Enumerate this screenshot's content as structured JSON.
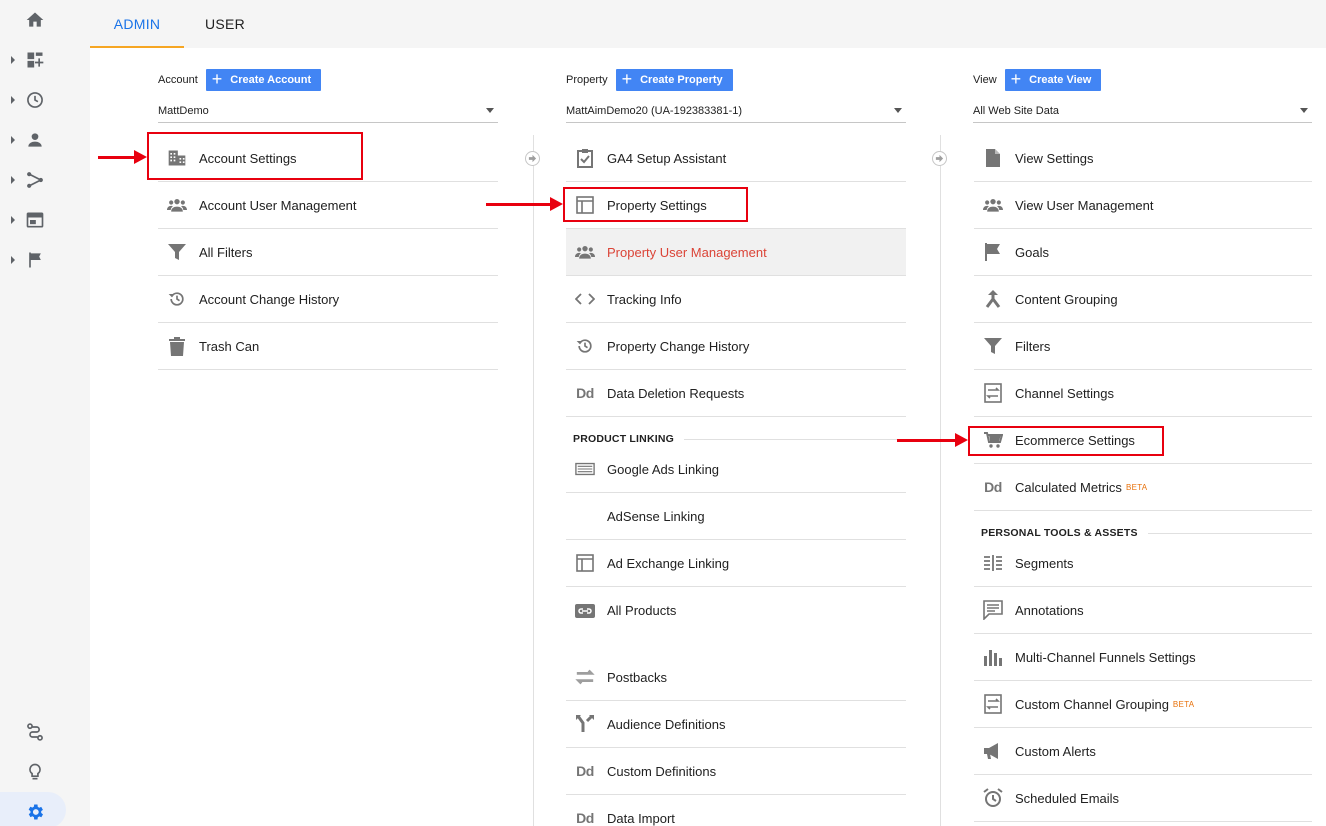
{
  "tabs": [
    {
      "label": "ADMIN",
      "active": true
    },
    {
      "label": "USER",
      "active": false
    }
  ],
  "rail": {
    "items": [
      "home-icon",
      "dashboard-icon",
      "realtime-icon",
      "audience-icon",
      "acquisition-icon",
      "behavior-icon",
      "conversions-icon"
    ],
    "bottom": [
      "attribution-icon",
      "discover-icon",
      "admin-gear-icon"
    ]
  },
  "account": {
    "label": "Account",
    "create_label": "Create Account",
    "selected": "MattDemo",
    "items": [
      {
        "label": "Account Settings",
        "icon": "building-icon"
      },
      {
        "label": "Account User Management",
        "icon": "people-icon"
      },
      {
        "label": "All Filters",
        "icon": "filter-icon"
      },
      {
        "label": "Account Change History",
        "icon": "history-icon"
      },
      {
        "label": "Trash Can",
        "icon": "trash-icon"
      }
    ]
  },
  "property": {
    "label": "Property",
    "create_label": "Create Property",
    "selected": "MattAimDemo20 (UA-192383381-1)",
    "items": [
      {
        "label": "GA4 Setup Assistant",
        "icon": "clipboard-check-icon"
      },
      {
        "label": "Property Settings",
        "icon": "layout-icon"
      },
      {
        "label": "Property User Management",
        "icon": "people-icon",
        "highlight": true
      },
      {
        "label": "Tracking Info",
        "icon": "code-icon"
      },
      {
        "label": "Property Change History",
        "icon": "history-icon"
      },
      {
        "label": "Data Deletion Requests",
        "icon": "dd-icon"
      }
    ],
    "section": "PRODUCT LINKING",
    "linking": [
      {
        "label": "Google Ads Linking",
        "icon": "ads-icon"
      },
      {
        "label": "AdSense Linking",
        "icon": ""
      },
      {
        "label": "Ad Exchange Linking",
        "icon": "layout-icon"
      },
      {
        "label": "All Products",
        "icon": "link-icon"
      },
      {
        "label": "Postbacks",
        "icon": "postbacks-icon"
      },
      {
        "label": "Audience Definitions",
        "icon": "fork-icon"
      },
      {
        "label": "Custom Definitions",
        "icon": "dd-icon"
      },
      {
        "label": "Data Import",
        "icon": "dd-icon"
      }
    ]
  },
  "view": {
    "label": "View",
    "create_label": "Create View",
    "selected": "All Web Site Data",
    "items": [
      {
        "label": "View Settings",
        "icon": "document-icon"
      },
      {
        "label": "View User Management",
        "icon": "people-icon"
      },
      {
        "label": "Goals",
        "icon": "flag-icon"
      },
      {
        "label": "Content Grouping",
        "icon": "merge-icon"
      },
      {
        "label": "Filters",
        "icon": "filter-icon"
      },
      {
        "label": "Channel Settings",
        "icon": "channel-icon"
      },
      {
        "label": "Ecommerce Settings",
        "icon": "cart-icon"
      },
      {
        "label": "Calculated Metrics",
        "icon": "dd-icon",
        "badge": "BETA"
      }
    ],
    "section": "PERSONAL TOOLS & ASSETS",
    "tools": [
      {
        "label": "Segments",
        "icon": "segments-icon"
      },
      {
        "label": "Annotations",
        "icon": "annotation-icon"
      },
      {
        "label": "Multi-Channel Funnels Settings",
        "icon": "bars-icon"
      },
      {
        "label": "Custom Channel Grouping",
        "icon": "channel-icon",
        "badge": "BETA"
      },
      {
        "label": "Custom Alerts",
        "icon": "megaphone-icon"
      },
      {
        "label": "Scheduled Emails",
        "icon": "alarm-icon"
      }
    ]
  },
  "dd_glyph": "Dd",
  "colors": {
    "accent": "#1a73e8",
    "button": "#4285f4",
    "highlight_text": "#db4437",
    "annotation_red": "#e8000f",
    "tab_underline": "#f6a623"
  }
}
